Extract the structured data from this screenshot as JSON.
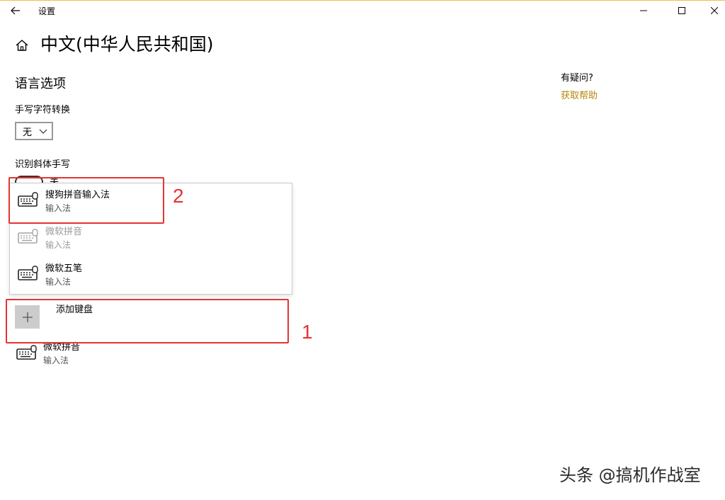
{
  "window": {
    "title": "设置",
    "minimize": "minimize",
    "maximize": "maximize",
    "close": "close"
  },
  "page": {
    "title": "中文(中华人民共和国)"
  },
  "language_options": {
    "section_title": "语言选项",
    "handwriting_conversion_label": "手写字符转换",
    "handwriting_conversion_value": "无",
    "cursive_label": "识别斜体手写",
    "cursive_toggle_text": "关"
  },
  "ime_popup": {
    "items": [
      {
        "name": "搜狗拼音输入法",
        "sub": "输入法",
        "enabled": true
      },
      {
        "name": "微软拼音",
        "sub": "输入法",
        "enabled": false
      },
      {
        "name": "微软五笔",
        "sub": "输入法",
        "enabled": true
      }
    ]
  },
  "keyboards": {
    "add_label": "添加键盘",
    "installed": [
      {
        "name": "微软拼音",
        "sub": "输入法"
      }
    ]
  },
  "help": {
    "question": "有疑问?",
    "link": "获取帮助"
  },
  "annotations": {
    "label_1": "1",
    "label_2": "2",
    "color": "#e53333"
  },
  "watermark": "头条 @搞机作战室",
  "colors": {
    "accent_link": "#b8860b",
    "add_tile": "#cccccc"
  }
}
